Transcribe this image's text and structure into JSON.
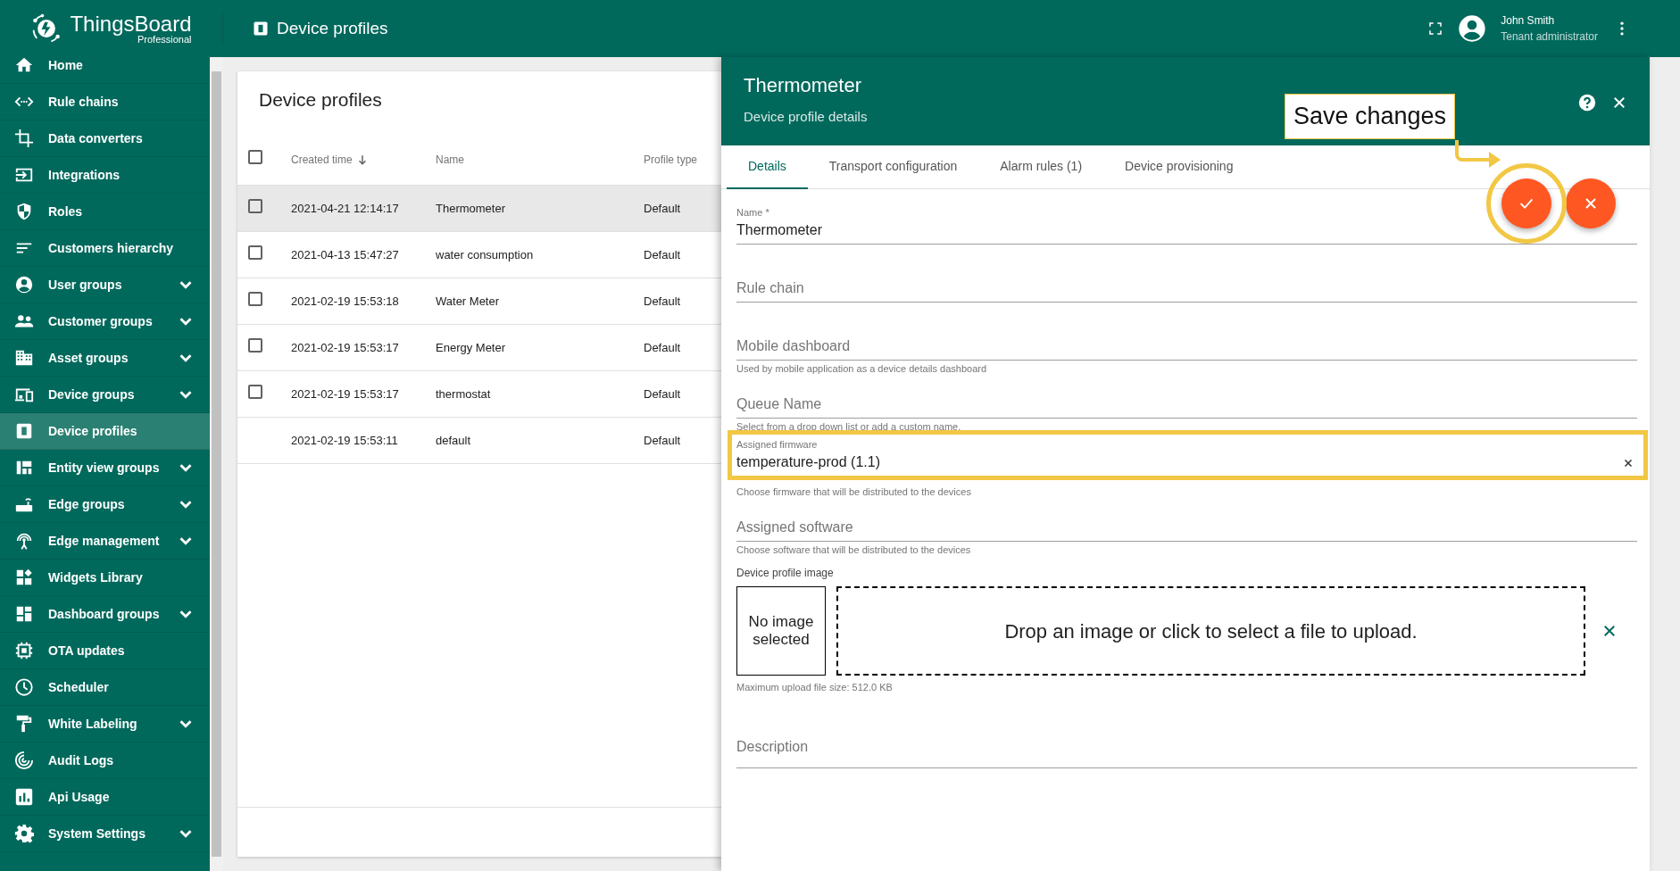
{
  "app": {
    "logo_title": "ThingsBoard",
    "logo_subtitle": "Professional"
  },
  "header": {
    "title": "Device profiles",
    "user_name": "John Smith",
    "user_role": "Tenant administrator"
  },
  "sidebar": {
    "items": [
      {
        "label": "Home",
        "selected": false
      },
      {
        "label": "Rule chains",
        "selected": false
      },
      {
        "label": "Data converters",
        "selected": false
      },
      {
        "label": "Integrations",
        "selected": false
      },
      {
        "label": "Roles",
        "selected": false
      },
      {
        "label": "Customers hierarchy",
        "selected": false
      },
      {
        "label": "User groups",
        "selected": false,
        "expanded": false
      },
      {
        "label": "Customer groups",
        "selected": false,
        "expanded": false
      },
      {
        "label": "Asset groups",
        "selected": false,
        "expanded": false
      },
      {
        "label": "Device groups",
        "selected": false,
        "expanded": false
      },
      {
        "label": "Device profiles",
        "selected": true
      },
      {
        "label": "Entity view groups",
        "selected": false,
        "expanded": false
      },
      {
        "label": "Edge groups",
        "selected": false,
        "expanded": false
      },
      {
        "label": "Edge management",
        "selected": false,
        "expanded": false
      },
      {
        "label": "Widgets Library",
        "selected": false
      },
      {
        "label": "Dashboard groups",
        "selected": false,
        "expanded": false
      },
      {
        "label": "OTA updates",
        "selected": false
      },
      {
        "label": "Scheduler",
        "selected": false
      },
      {
        "label": "White Labeling",
        "selected": false,
        "expanded": false
      },
      {
        "label": "Audit Logs",
        "selected": false
      },
      {
        "label": "Api Usage",
        "selected": false
      },
      {
        "label": "System Settings",
        "selected": false,
        "expanded": false
      }
    ]
  },
  "table": {
    "title": "Device profiles",
    "header_checked": false,
    "columns": [
      {
        "label": "Created time",
        "sorted": true
      },
      {
        "label": "Name"
      },
      {
        "label": "Profile type"
      }
    ],
    "rows": [
      {
        "created_time": "2021-04-21 12:14:17",
        "name": "Thermometer",
        "profile_type": "Default",
        "selected": true,
        "checked": false
      },
      {
        "created_time": "2021-04-13 15:47:27",
        "name": "water consumption",
        "profile_type": "Default",
        "selected": false,
        "checked": false
      },
      {
        "created_time": "2021-02-19 15:53:18",
        "name": "Water Meter",
        "profile_type": "Default",
        "selected": false,
        "checked": false
      },
      {
        "created_time": "2021-02-19 15:53:17",
        "name": "Energy Meter",
        "profile_type": "Default",
        "selected": false,
        "checked": false
      },
      {
        "created_time": "2021-02-19 15:53:17",
        "name": "thermostat",
        "profile_type": "Default",
        "selected": false,
        "checked": false
      },
      {
        "created_time": "2021-02-19 15:53:11",
        "name": "default",
        "profile_type": "Default",
        "selected": false
      }
    ]
  },
  "details": {
    "title": "Thermometer",
    "subtitle": "Device profile details",
    "tooltip": "Save changes",
    "save_highlighted": true,
    "tabs": [
      {
        "label": "Details",
        "selected": true
      },
      {
        "label": "Transport configuration",
        "selected": false
      },
      {
        "label": "Alarm rules (1)",
        "selected": false
      },
      {
        "label": "Device provisioning",
        "selected": false
      }
    ],
    "fields": [
      {
        "label": "Name *",
        "value": "Thermometer",
        "highlighted": false
      },
      {
        "label": "Rule chain",
        "highlighted": false
      },
      {
        "label": "Mobile dashboard",
        "hint": "Used by mobile application as a device details dashboard",
        "highlighted": false
      },
      {
        "label": "Queue Name",
        "hint": "Select from a drop down list or add a custom name.",
        "highlighted": false
      },
      {
        "label": "Assigned firmware",
        "value": "temperature-prod (1.1)",
        "hint": "Choose firmware that will be distributed to the devices",
        "highlighted": true,
        "clearable": true
      },
      {
        "label": "Assigned software",
        "hint": "Choose software that will be distributed to the devices",
        "highlighted": false
      }
    ],
    "image": {
      "label": "Device profile image",
      "empty_text": "No image selected",
      "drop_text": "Drop an image or click to select a file to upload.",
      "hint": "Maximum upload file size: 512.0 KB"
    },
    "description": {
      "label": "Description"
    }
  }
}
